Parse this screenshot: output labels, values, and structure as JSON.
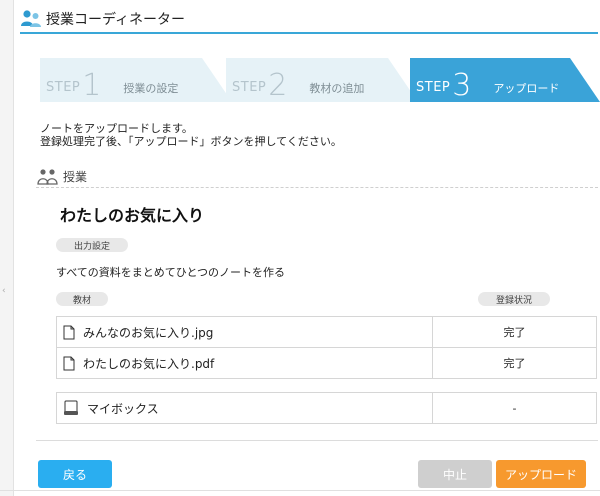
{
  "app": {
    "title": "授業コーディネーター"
  },
  "steps": [
    {
      "label": "STEP",
      "number": "1",
      "name": "授業の設定",
      "active": false
    },
    {
      "label": "STEP",
      "number": "2",
      "name": "教材の追加",
      "active": false
    },
    {
      "label": "STEP",
      "number": "3",
      "name": "アップロード",
      "active": true
    }
  ],
  "instructions": {
    "line1": "ノートをアップロードします。",
    "line2": "登録処理完了後、「アップロード」ボタンを押してください。"
  },
  "section": {
    "label": "授業"
  },
  "class": {
    "title": "わたしのお気に入り"
  },
  "output_settings": {
    "pill": "出力設定",
    "option": "すべての資料をまとめてひとつのノートを作る"
  },
  "materials": {
    "header_material": "教材",
    "header_status": "登録状況",
    "rows": [
      {
        "icon": "file-icon",
        "name": "みんなのお気に入り.jpg",
        "status": "完了"
      },
      {
        "icon": "file-icon",
        "name": "わたしのお気に入り.pdf",
        "status": "完了"
      },
      {
        "icon": "box-icon",
        "name": "マイボックス",
        "status": "-"
      }
    ]
  },
  "buttons": {
    "back": "戻る",
    "cancel": "中止",
    "upload": "アップロード"
  },
  "colors": {
    "accent": "#39a7d8",
    "step_active": "#3aa3d8",
    "step_inactive": "#e6f2f7",
    "back_button": "#2aaef0",
    "cancel_button": "#cfcfcf",
    "upload_button": "#f7992e"
  }
}
